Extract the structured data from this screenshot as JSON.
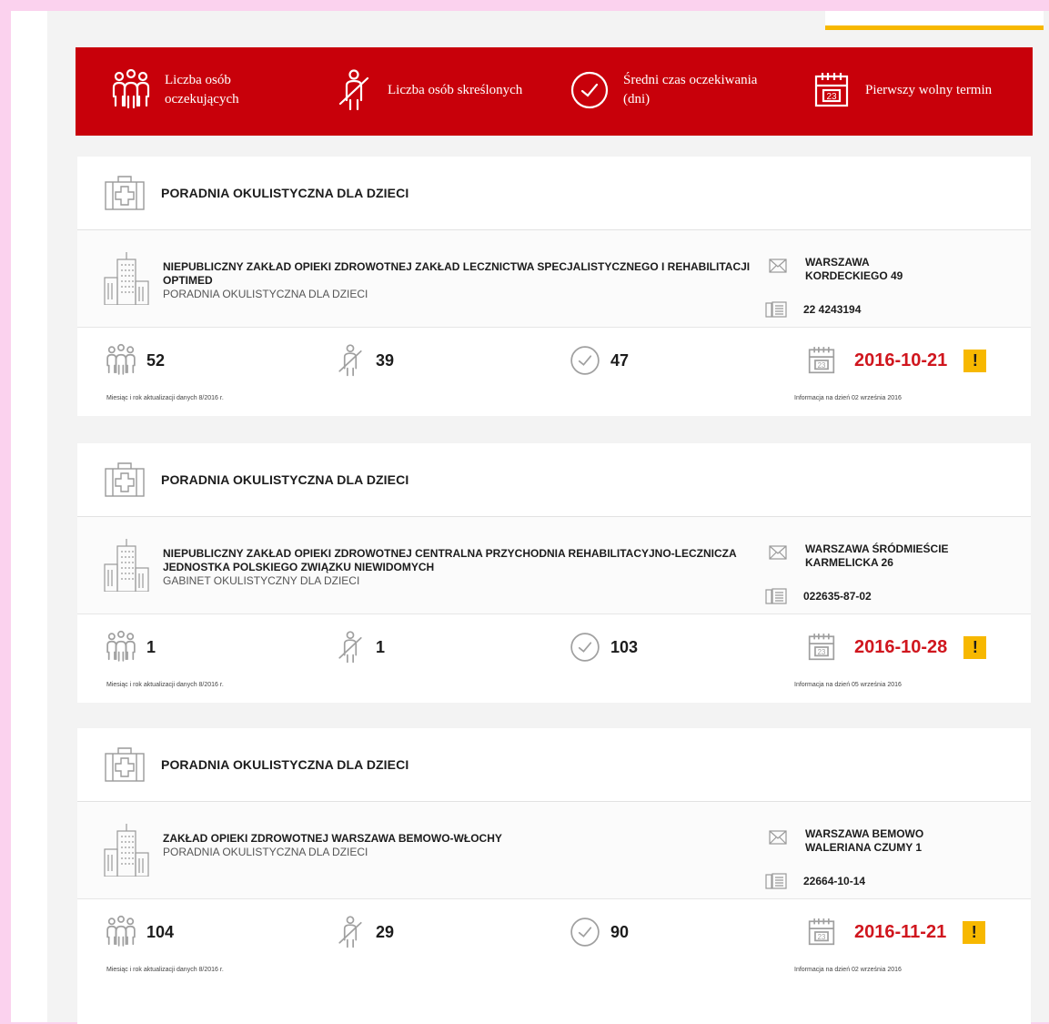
{
  "legend": [
    {
      "label": "Liczba osób oczekujących",
      "icon": "people-waiting-icon"
    },
    {
      "label": "Liczba osób skreślonych",
      "icon": "person-removed-icon"
    },
    {
      "label": "Średni czas oczekiwania (dni)",
      "icon": "clock-icon"
    },
    {
      "label": "Pierwszy wolny termin",
      "icon": "calendar-icon"
    }
  ],
  "colors": {
    "brand_red": "#c8000a",
    "date_red": "#d0161e",
    "warning_yellow": "#f7b800",
    "background_pink": "#fbd2ee"
  },
  "results": [
    {
      "clinic": "PORADNIA OKULISTYCZNA DLA DZIECI",
      "institution": "NIEPUBLICZNY ZAKŁAD OPIEKI ZDROWOTNEJ ZAKŁAD LECZNICTWA SPECJALISTYCZNEGO I REHABILITACJI OPTIMED",
      "unit": "PORADNIA OKULISTYCZNA DLA DZIECI",
      "city": "WARSZAWA",
      "street": "KORDECKIEGO 49",
      "phone": "22 4243194",
      "waiting": "52",
      "removed": "39",
      "avg_days": "47",
      "first_date": "2016-10-21",
      "warning": "!",
      "update_note": "Miesiąc i rok aktualizacji danych 8/2016 r.",
      "info_note": "Informacja na dzień 02 września 2016"
    },
    {
      "clinic": "PORADNIA OKULISTYCZNA DLA DZIECI",
      "institution": "NIEPUBLICZNY ZAKŁAD OPIEKI ZDROWOTNEJ CENTRALNA PRZYCHODNIA REHABILITACYJNO-LECZNICZA JEDNOSTKA POLSKIEGO ZWIĄZKU NIEWIDOMYCH",
      "unit": "GABINET OKULISTYCZNY DLA DZIECI",
      "city": "WARSZAWA ŚRÓDMIEŚCIE",
      "street": "KARMELICKA 26",
      "phone": "022635-87-02",
      "waiting": "1",
      "removed": "1",
      "avg_days": "103",
      "first_date": "2016-10-28",
      "warning": "!",
      "update_note": "Miesiąc i rok aktualizacji danych 8/2016 r.",
      "info_note": "Informacja na dzień 05 września 2016"
    },
    {
      "clinic": "PORADNIA OKULISTYCZNA DLA DZIECI",
      "institution": "ZAKŁAD OPIEKI ZDROWOTNEJ WARSZAWA BEMOWO-WŁOCHY",
      "unit": "PORADNIA OKULISTYCZNA DLA DZIECI",
      "city": "WARSZAWA BEMOWO",
      "street": "WALERIANA CZUMY 1",
      "phone": "22664-10-14",
      "waiting": "104",
      "removed": "29",
      "avg_days": "90",
      "first_date": "2016-11-21",
      "warning": "!",
      "update_note": "Miesiąc i rok aktualizacji danych 8/2016 r.",
      "info_note": "Informacja na dzień 02 września 2016"
    }
  ]
}
